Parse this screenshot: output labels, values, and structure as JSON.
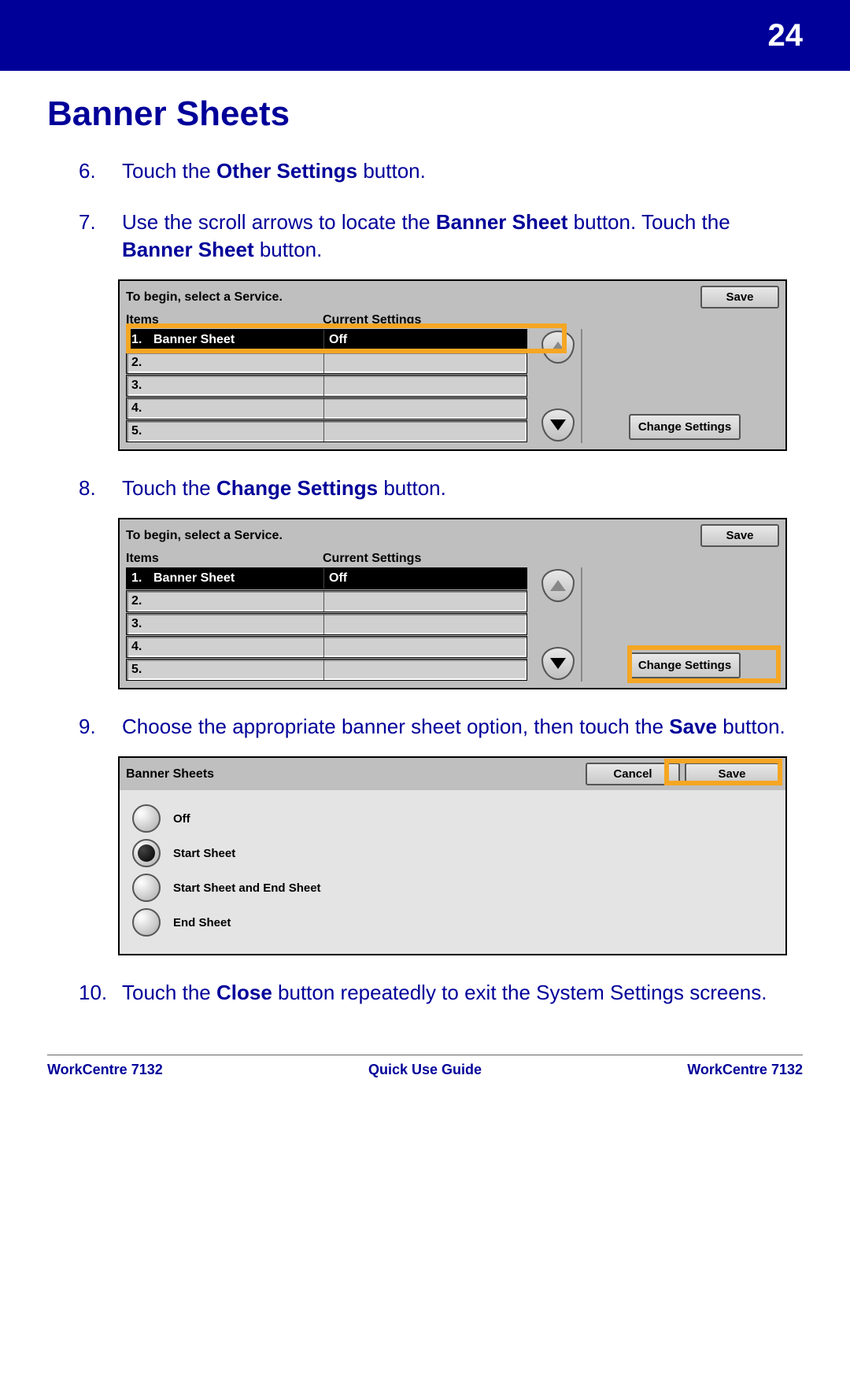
{
  "page_number": "24",
  "title": "Banner Sheets",
  "steps": [
    {
      "n": "6.",
      "pre": "Touch the ",
      "bold": "Other Settings",
      "post": " button."
    },
    {
      "n": "7.",
      "pre": "Use the scroll arrows to locate the ",
      "bold": "Banner Sheet",
      "mid": " button. Touch the ",
      "bold2": "Banner Sheet",
      "post": " button."
    },
    {
      "n": "8.",
      "pre": "Touch the ",
      "bold": "Change Settings",
      "post": " button."
    },
    {
      "n": "9.",
      "pre": "Choose the appropriate banner sheet option, then touch the ",
      "bold": "Save",
      "post": " button."
    },
    {
      "n": "10.",
      "pre": "Touch the ",
      "bold": "Close",
      "post": " button repeatedly to exit the System Settings screens."
    }
  ],
  "panel": {
    "prompt": "To begin, select a Service.",
    "save": "Save",
    "items_hdr": "Items",
    "settings_hdr": "Current Settings",
    "change": "Change Settings",
    "rows": [
      {
        "n": "1.",
        "name": "Banner Sheet",
        "val": "Off"
      },
      {
        "n": "2.",
        "name": "",
        "val": ""
      },
      {
        "n": "3.",
        "name": "",
        "val": ""
      },
      {
        "n": "4.",
        "name": "",
        "val": ""
      },
      {
        "n": "5.",
        "name": "",
        "val": ""
      }
    ]
  },
  "panel3": {
    "title": "Banner Sheets",
    "cancel": "Cancel",
    "save": "Save",
    "options": [
      {
        "label": "Off",
        "selected": false
      },
      {
        "label": "Start Sheet",
        "selected": true
      },
      {
        "label": "Start Sheet and End Sheet",
        "selected": false
      },
      {
        "label": "End Sheet",
        "selected": false
      }
    ]
  },
  "footer": {
    "left": "WorkCentre 7132",
    "center": "Quick Use Guide",
    "right": "WorkCentre 7132"
  }
}
